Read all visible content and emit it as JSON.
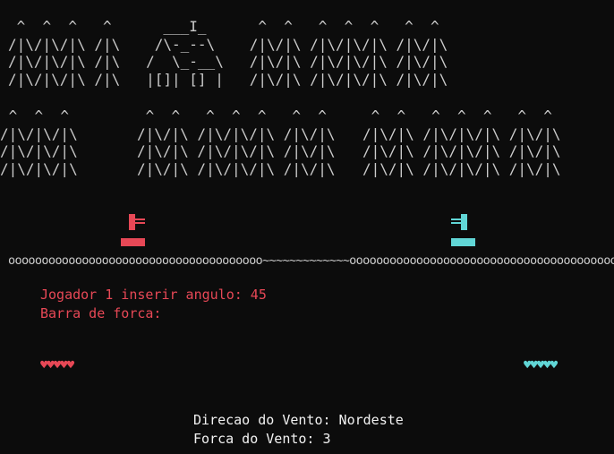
{
  "scene": {
    "city_row_1": [
      " ^  ^  ^   ^      ___I_      ^  ^   ^  ^  ^   ^  ^",
      "/|\\/|\\/|\\ /|\\    /\\-_--\\    /|\\/|\\ /|\\/|\\/|\\ /|\\/|\\",
      "/|\\/|\\/|\\ /|\\   /  \\_-__\\   /|\\/|\\ /|\\/|\\/|\\ /|\\/|\\",
      "/|\\/|\\/|\\ /|\\   |[]| [] |   /|\\/|\\ /|\\/|\\/|\\ /|\\/|\\"
    ],
    "forest_left": [
      " ^  ^  ^",
      "/|\\/|\\/|\\",
      "/|\\/|\\/|\\",
      "/|\\/|\\/|\\"
    ],
    "forest_mid": [
      " ^  ^   ^  ^  ^   ^  ^",
      "/|\\/|\\ /|\\/|\\/|\\ /|\\/|\\",
      "/|\\/|\\ /|\\/|\\/|\\ /|\\/|\\",
      "/|\\/|\\ /|\\/|\\/|\\ /|\\/|\\"
    ],
    "forest_right": [
      " ^  ^   ^  ^  ^   ^  ^",
      "/|\\/|\\ /|\\/|\\/|\\ /|\\/|\\",
      "/|\\/|\\ /|\\/|\\/|\\ /|\\/|\\",
      "/|\\/|\\ /|\\/|\\/|\\ /|\\/|\\"
    ],
    "ground": "oooooooooooooooooooooooooooooooooooooo~~~~~~~~~~~~~oooooooooooooooooooooooooooooooooooooooooo"
  },
  "prompt": {
    "angle_line": "Jogador 1 inserir angulo: 45",
    "force_bar_label": "Barra de forca:"
  },
  "players": {
    "player1": {
      "hearts": "♥♥♥♥♥",
      "color": "#e74856"
    },
    "player2": {
      "hearts": "♥♥♥♥♥",
      "color": "#61d6d6"
    }
  },
  "wind": {
    "direction_line": "Direcao do Vento: Nordeste",
    "force_line": "Forca do Vento: 3"
  }
}
